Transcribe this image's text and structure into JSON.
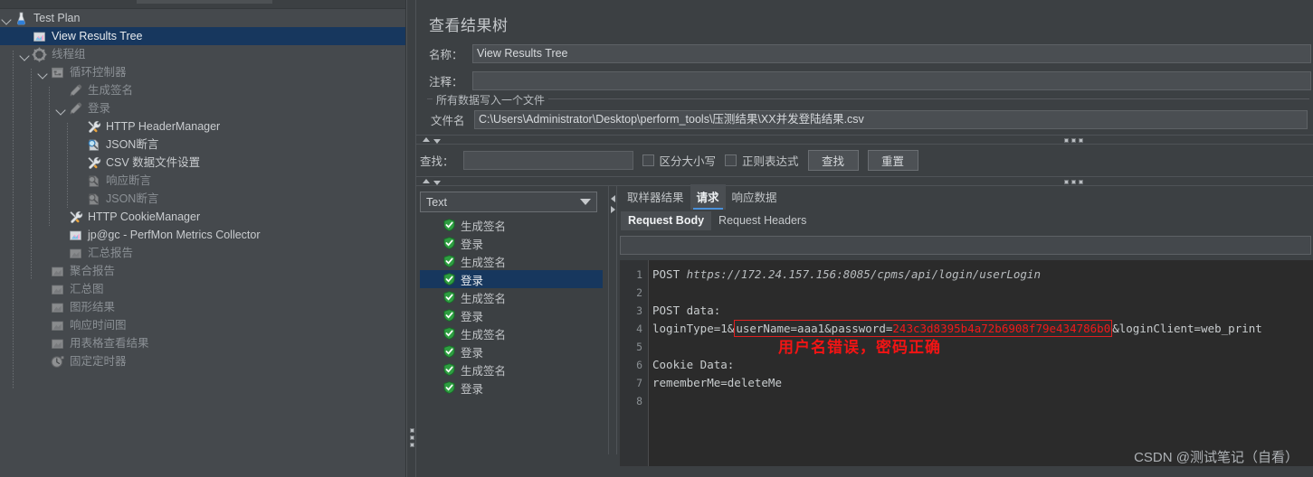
{
  "window": {
    "root_label": "Test Plan"
  },
  "tree": {
    "items": [
      {
        "label": "Test Plan",
        "indent": 0,
        "icon": "testplan-icon",
        "twisty": "down",
        "selected": false,
        "dim": false
      },
      {
        "label": "View Results Tree",
        "indent": 1,
        "icon": "listener-icon",
        "twisty": "",
        "selected": true,
        "dim": false
      },
      {
        "label": "线程组",
        "indent": 1,
        "icon": "threadgroup-icon",
        "twisty": "down",
        "selected": false,
        "dim": true
      },
      {
        "label": "循环控制器",
        "indent": 2,
        "icon": "controller-icon",
        "twisty": "down",
        "selected": false,
        "dim": true
      },
      {
        "label": "生成签名",
        "indent": 3,
        "icon": "sampler-icon",
        "twisty": "",
        "selected": false,
        "dim": true
      },
      {
        "label": "登录",
        "indent": 3,
        "icon": "sampler-icon",
        "twisty": "down",
        "selected": false,
        "dim": true
      },
      {
        "label": "HTTP HeaderManager",
        "indent": 4,
        "icon": "config-icon",
        "twisty": "",
        "selected": false,
        "dim": false
      },
      {
        "label": "JSON断言",
        "indent": 4,
        "icon": "assertion-icon",
        "twisty": "",
        "selected": false,
        "dim": false
      },
      {
        "label": "CSV 数据文件设置",
        "indent": 4,
        "icon": "config-icon",
        "twisty": "",
        "selected": false,
        "dim": false
      },
      {
        "label": "响应断言",
        "indent": 4,
        "icon": "assertion-icon",
        "twisty": "",
        "selected": false,
        "dim": true
      },
      {
        "label": "JSON断言",
        "indent": 4,
        "icon": "assertion-icon",
        "twisty": "",
        "selected": false,
        "dim": true
      },
      {
        "label": "HTTP CookieManager",
        "indent": 3,
        "icon": "config-icon",
        "twisty": "",
        "selected": false,
        "dim": false
      },
      {
        "label": "jp@gc - PerfMon Metrics Collector",
        "indent": 3,
        "icon": "listener-icon",
        "twisty": "",
        "selected": false,
        "dim": false
      },
      {
        "label": "汇总报告",
        "indent": 3,
        "icon": "listener-icon",
        "twisty": "",
        "selected": false,
        "dim": true
      },
      {
        "label": "聚合报告",
        "indent": 2,
        "icon": "listener-icon",
        "twisty": "",
        "selected": false,
        "dim": true
      },
      {
        "label": "汇总图",
        "indent": 2,
        "icon": "listener-icon",
        "twisty": "",
        "selected": false,
        "dim": true
      },
      {
        "label": "图形结果",
        "indent": 2,
        "icon": "listener-icon",
        "twisty": "",
        "selected": false,
        "dim": true
      },
      {
        "label": "响应时间图",
        "indent": 2,
        "icon": "listener-icon",
        "twisty": "",
        "selected": false,
        "dim": true
      },
      {
        "label": "用表格查看结果",
        "indent": 2,
        "icon": "listener-icon",
        "twisty": "",
        "selected": false,
        "dim": true
      },
      {
        "label": "固定定时器",
        "indent": 2,
        "icon": "timer-icon",
        "twisty": "",
        "selected": false,
        "dim": true
      }
    ]
  },
  "panel": {
    "title": "查看结果树",
    "name_label": "名称：",
    "name_value": "View Results Tree",
    "comment_label": "注释：",
    "comment_value": "",
    "group_legend": "所有数据写入一个文件",
    "filename_label": "文件名",
    "filename_value": "C:\\Users\\Administrator\\Desktop\\perform_tools\\压测结果\\XX并发登陆结果.csv"
  },
  "search": {
    "label": "查找：",
    "value": "",
    "case_sensitive_label": "区分大小写",
    "regex_label": "正则表达式",
    "find_button": "查找",
    "reset_button": "重置"
  },
  "renderer": {
    "selected": "Text"
  },
  "results": {
    "rows": [
      {
        "label": "生成签名",
        "status": "success",
        "selected": false
      },
      {
        "label": "登录",
        "status": "success",
        "selected": false
      },
      {
        "label": "生成签名",
        "status": "success",
        "selected": false
      },
      {
        "label": "登录",
        "status": "success",
        "selected": true
      },
      {
        "label": "生成签名",
        "status": "success",
        "selected": false
      },
      {
        "label": "登录",
        "status": "success",
        "selected": false
      },
      {
        "label": "生成签名",
        "status": "success",
        "selected": false
      },
      {
        "label": "登录",
        "status": "success",
        "selected": false
      },
      {
        "label": "生成签名",
        "status": "success",
        "selected": false
      },
      {
        "label": "登录",
        "status": "success",
        "selected": false
      }
    ]
  },
  "detail": {
    "tabs": [
      {
        "label": "取样器结果",
        "active": false
      },
      {
        "label": "请求",
        "active": true
      },
      {
        "label": "响应数据",
        "active": false
      }
    ],
    "subtabs": [
      {
        "label": "Request Body",
        "active": true
      },
      {
        "label": "Request Headers",
        "active": false
      }
    ],
    "search_value": "",
    "line_numbers": [
      "1",
      "2",
      "3",
      "4",
      "5",
      "6",
      "7",
      "8"
    ],
    "code": {
      "line1_method": "POST ",
      "line1_url": "https://172.24.157.156:8085/cpms/api/login/userLogin",
      "line3": "POST data:",
      "line4_prefix": "loginType=1&",
      "line4_boxed_plain": "userName=aaa1&password=",
      "line4_boxed_red": "243c3d8395b4a72b6908f79e434786b0",
      "line4_suffix": "&loginClient=web_print",
      "line6": "Cookie Data:",
      "line7": "rememberMe=deleteMe"
    },
    "annotation": "用户名错误，密码正确"
  },
  "watermark": "CSDN @测试笔记（自看）",
  "colors": {
    "background": "#3c4043",
    "tree_background": "#45494d",
    "selection": "#17375e",
    "accent_tab": "#4a90d9",
    "code_background": "#2b2b2b",
    "annotation_red": "#f21414",
    "success_green": "#2e9e41"
  }
}
